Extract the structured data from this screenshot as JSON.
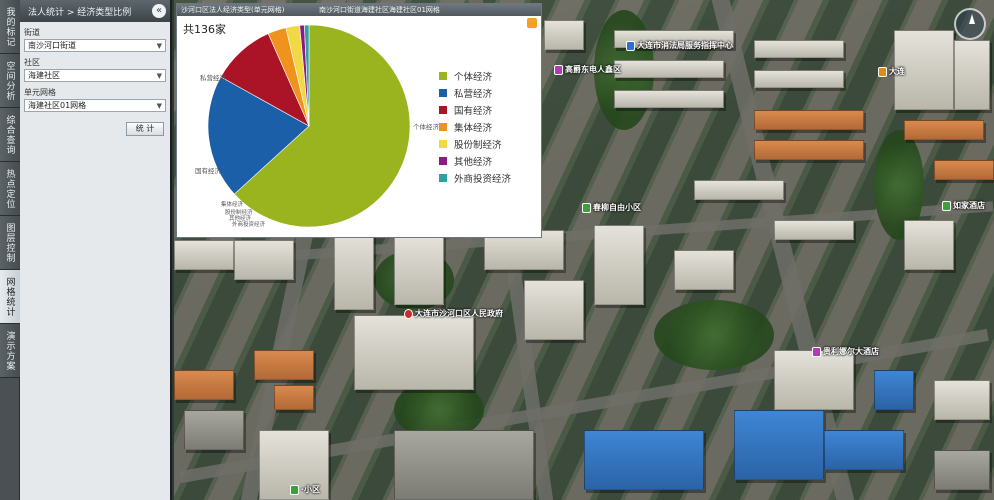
{
  "vtabs": [
    "我的标记",
    "空间分析",
    "综合查询",
    "热点定位",
    "图层控制",
    "网格统计",
    "演示方案"
  ],
  "panel": {
    "breadcrumb": "法人统计 > 经济类型比例",
    "fields": [
      {
        "label": "街道",
        "value": "南沙河口街道"
      },
      {
        "label": "社区",
        "value": "海建社区"
      },
      {
        "label": "单元网格",
        "value": "海建社区01网格"
      }
    ],
    "stat_button": "统 计"
  },
  "popup": {
    "title_left": "沙河口区法人经济类型(单元网格)",
    "title_right": "南沙河口街道海建社区海建社区01网格",
    "total": "共136家"
  },
  "chart_data": {
    "type": "pie",
    "title": "共136家",
    "slices": [
      {
        "name": "个体经济",
        "value": 86,
        "color": "#99b41f",
        "label": "个体经济"
      },
      {
        "name": "私营经济",
        "value": 27,
        "color": "#1b5fa8",
        "label": "私营经济"
      },
      {
        "name": "国有经济",
        "value": 14,
        "color": "#ab1327",
        "label": "国有经济"
      },
      {
        "name": "集体经济",
        "value": 4,
        "color": "#f0931e",
        "label": "集体经济"
      },
      {
        "name": "股份制经济",
        "value": 3,
        "color": "#f1d845",
        "label": "股份制经济"
      },
      {
        "name": "其他经济",
        "value": 1,
        "color": "#8b1a82",
        "label": "其他经济"
      },
      {
        "name": "外商投资经济",
        "value": 1,
        "color": "#2da39f",
        "label": "外商投资经济"
      }
    ],
    "legend_position": "right"
  },
  "map": {
    "pois": [
      {
        "name": "大连市沙河口区人民政府",
        "kind": "r"
      },
      {
        "name": "大连市消法局服务指挥中心",
        "kind": "b"
      },
      {
        "name": "高爵东电人鑫区",
        "kind": "p"
      },
      {
        "name": "春柳自由小区",
        "kind": "g"
      },
      {
        "name": "如家酒店",
        "kind": "g"
      },
      {
        "name": "贵利娜尔大酒店",
        "kind": "p"
      },
      {
        "name": "大连",
        "kind": "o"
      },
      {
        "name": "·小区",
        "kind": "g"
      }
    ]
  }
}
